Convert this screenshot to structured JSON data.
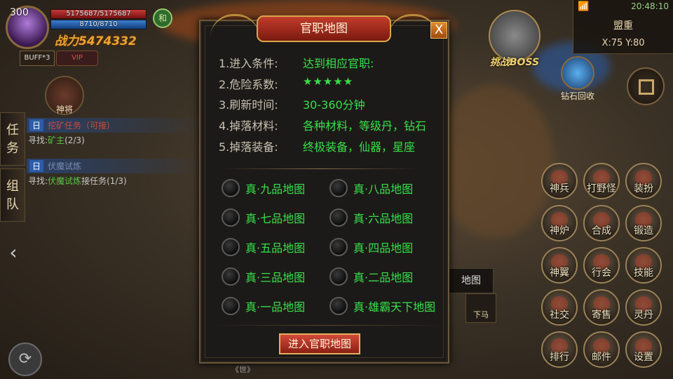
{
  "hud": {
    "level": "300",
    "hp": "5175687/5175687",
    "mp": "8710/8710",
    "power": "战力5474332",
    "buff": "BUFF*3",
    "vip": "VIP",
    "mode": "和",
    "pet_label": "神将"
  },
  "tasks": {
    "tab_task": [
      "任",
      "务"
    ],
    "tab_team": [
      "组",
      "队"
    ],
    "items": [
      {
        "tag": "日",
        "name": "挖矿任务（可接）",
        "line_prefix": "寻找:",
        "line_link": "矿主",
        "line_suffix": "(2/3)"
      },
      {
        "tag": "日",
        "name": "伏魔试炼",
        "line_prefix": "寻找:",
        "line_link": "伏魔试炼",
        "line_suffix": "接任务(1/3)"
      }
    ]
  },
  "topright": {
    "time": "20:48:10",
    "map_name": "盟重",
    "coords": "X:75  Y:80"
  },
  "top_icons": {
    "boss": "挑战BOSS",
    "diamond_recycle": "钻石回收"
  },
  "dialog": {
    "title": "官职地图",
    "close": "X",
    "info": [
      {
        "label": "1.进入条件:",
        "value": "达到相应官职:"
      },
      {
        "label": "2.危险系数:",
        "value": "★★★★★"
      },
      {
        "label": "3.刷新时间:",
        "value": "30-360分钟"
      },
      {
        "label": "4.掉落材料:",
        "value": "各种材料，等级丹，钻石"
      },
      {
        "label": "5.掉落装备:",
        "value": "终极装备，仙器，星座"
      }
    ],
    "options": [
      "真·九品地图",
      "真·八品地图",
      "真·七品地图",
      "真·六品地图",
      "真·五品地图",
      "真·四品地图",
      "真·三品地图",
      "真·二品地图",
      "真·一品地图",
      "真·雄霸天下地图"
    ],
    "enter_button": "进入官职地图"
  },
  "map_tip": "地图",
  "dismount": "下马",
  "right_buttons": [
    "神兵",
    "打野怪",
    "装扮",
    "神炉",
    "合成",
    "锻造",
    "神翼",
    "行会",
    "技能",
    "社交",
    "寄售",
    "灵丹",
    "排行",
    "邮件",
    "设置"
  ],
  "bottom_chat": "《世》",
  "colors": {
    "accent_green": "#37e04a",
    "title_red": "#c23c2a",
    "star_red": "#e02020",
    "gold": "#d8a84a"
  }
}
